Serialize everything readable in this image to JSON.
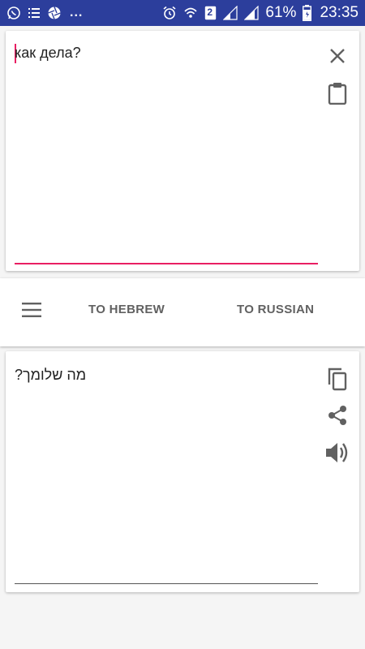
{
  "status_bar": {
    "background": "#2c3e9c",
    "left_icons": [
      "whatsapp-icon",
      "list-icon",
      "aperture-icon"
    ],
    "more_indicator": "...",
    "right_icons": [
      "alarm-icon",
      "wifi-icon",
      "sim-icon",
      "signal-icon",
      "signal-icon-2",
      "battery-icon"
    ],
    "sim_badge": "2",
    "battery": "61%",
    "time": "23:35"
  },
  "input_card": {
    "text": "как дела?",
    "accent_color": "#e91e63",
    "icons": [
      "close-icon",
      "paste-icon"
    ]
  },
  "toolbar": {
    "menu_icon": "menu-icon",
    "to_hebrew": "TO HEBREW",
    "to_russian": "TO RUSSIAN"
  },
  "output_card": {
    "text": "מה שלומך?",
    "icons": [
      "copy-icon",
      "share-icon",
      "volume-icon"
    ]
  }
}
